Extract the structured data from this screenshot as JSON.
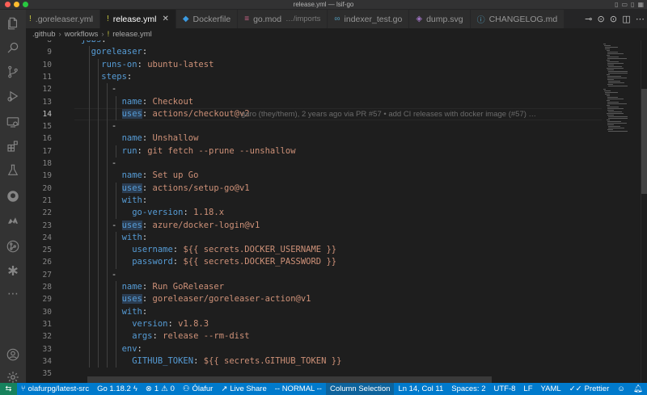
{
  "window": {
    "title": "release.yml — lsif-go"
  },
  "tabs": [
    {
      "label": ".goreleaser.yml",
      "icon": "!",
      "active": false
    },
    {
      "label": "release.yml",
      "icon": "!",
      "active": true
    },
    {
      "label": "Dockerfile",
      "icon": "🐳",
      "active": false
    },
    {
      "label": "go.mod",
      "desc": "…/imports",
      "icon": "≡",
      "active": false
    },
    {
      "label": "indexer_test.go",
      "icon": "∞",
      "active": false
    },
    {
      "label": "dump.svg",
      "icon": "◈",
      "active": false
    },
    {
      "label": "CHANGELOG.md",
      "icon": "ⓘ",
      "active": false
    }
  ],
  "breadcrumb": {
    "parts": [
      ".github",
      "workflows",
      "release.yml"
    ]
  },
  "editor": {
    "current_line": 14,
    "blame": "garo (they/them), 2 years ago via PR #57 • add CI releases with docker image (#57) …",
    "lines": [
      {
        "n": "8",
        "text": "jobs:"
      },
      {
        "n": "9",
        "text": "  goreleaser:"
      },
      {
        "n": "10",
        "text": "    runs-on: ubuntu-latest"
      },
      {
        "n": "11",
        "text": "    steps:"
      },
      {
        "n": "12",
        "text": "      -"
      },
      {
        "n": "13",
        "text": "        name: Checkout"
      },
      {
        "n": "14",
        "text": "        uses: actions/checkout@v2"
      },
      {
        "n": "15",
        "text": "      -"
      },
      {
        "n": "16",
        "text": "        name: Unshallow"
      },
      {
        "n": "17",
        "text": "        run: git fetch --prune --unshallow"
      },
      {
        "n": "18",
        "text": "      -"
      },
      {
        "n": "19",
        "text": "        name: Set up Go"
      },
      {
        "n": "20",
        "text": "        uses: actions/setup-go@v1"
      },
      {
        "n": "21",
        "text": "        with:"
      },
      {
        "n": "22",
        "text": "          go-version: 1.18.x"
      },
      {
        "n": "23",
        "text": "      - uses: azure/docker-login@v1"
      },
      {
        "n": "24",
        "text": "        with:"
      },
      {
        "n": "25",
        "text": "          username: ${{ secrets.DOCKER_USERNAME }}"
      },
      {
        "n": "26",
        "text": "          password: ${{ secrets.DOCKER_PASSWORD }}"
      },
      {
        "n": "27",
        "text": "      -"
      },
      {
        "n": "28",
        "text": "        name: Run GoReleaser"
      },
      {
        "n": "29",
        "text": "        uses: goreleaser/goreleaser-action@v1"
      },
      {
        "n": "30",
        "text": "        with:"
      },
      {
        "n": "31",
        "text": "          version: v1.8.3"
      },
      {
        "n": "32",
        "text": "          args: release --rm-dist"
      },
      {
        "n": "33",
        "text": "        env:"
      },
      {
        "n": "34",
        "text": "          GITHUB_TOKEN: ${{ secrets.GITHUB_TOKEN }}"
      },
      {
        "n": "35",
        "text": ""
      }
    ]
  },
  "statusbar": {
    "branch": "olafurpg/latest-src",
    "go_version": "Go 1.18.2",
    "errors": "1",
    "warnings": "0",
    "user": "Ólafur",
    "live_share": "Live Share",
    "vim_mode": "-- NORMAL --",
    "column_selection": "Column Selection",
    "cursor": "Ln 14, Col 11",
    "spaces": "Spaces: 2",
    "encoding": "UTF-8",
    "eol": "LF",
    "language": "YAML",
    "formatter": "Prettier"
  },
  "colors": {
    "accent": "#007acc",
    "keyword": "#569cd6",
    "string": "#ce9178"
  }
}
